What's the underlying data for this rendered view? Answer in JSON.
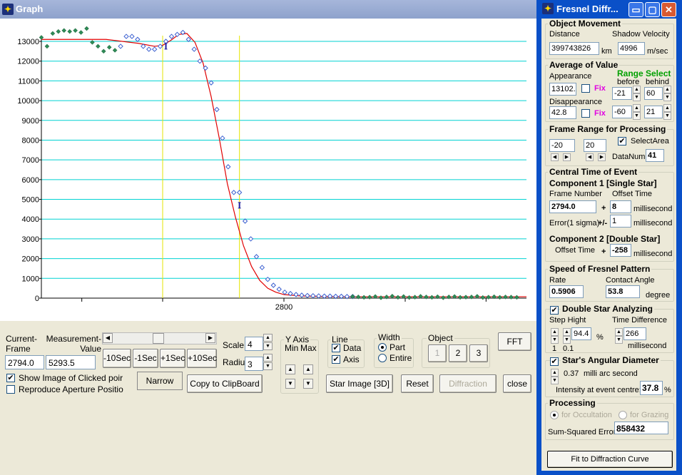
{
  "graph_window": {
    "title": "Graph"
  },
  "chart_data": {
    "type": "scatter",
    "title": "",
    "xlabel": "",
    "ylabel": "",
    "ylim": [
      0,
      14000
    ],
    "yticks": [
      0,
      1000,
      2000,
      3000,
      4000,
      5000,
      6000,
      7000,
      8000,
      9000,
      10000,
      11000,
      12000,
      13000
    ],
    "xtick_labels": [
      "2800"
    ],
    "xtick_values": [
      2800
    ],
    "xlim": [
      2770,
      2830
    ],
    "grid": "horizontal",
    "vertical_markers": [
      2785,
      2794.5
    ],
    "colors": {
      "observed": "#2e8b57",
      "used": "#3a5fd0",
      "fit": "#e00000",
      "grid": "#00d2d2",
      "marker": "#e6e600"
    },
    "series": [
      {
        "kind": "observed",
        "x": [
          2770,
          2770.7,
          2771.4,
          2772.1,
          2772.8,
          2773.5,
          2774.2,
          2774.9,
          2775.6,
          2776.3,
          2777,
          2777.7,
          2778.4,
          2779.1
        ],
        "y": [
          13200,
          12750,
          13400,
          13500,
          13550,
          13500,
          13550,
          13450,
          13650,
          12950,
          12750,
          12500,
          12700,
          12550
        ]
      },
      {
        "kind": "used",
        "x": [
          2779.8,
          2780.5,
          2781.2,
          2781.9,
          2782.6,
          2783.3,
          2784,
          2784.7,
          2785.4,
          2786.1,
          2786.8,
          2787.5,
          2788.2,
          2788.9,
          2789.6,
          2790.3,
          2791,
          2791.7,
          2792.4,
          2793.1,
          2793.8,
          2794.5,
          2795.2,
          2795.9,
          2796.6,
          2797.3,
          2798,
          2798.7,
          2799.4,
          2800.1,
          2800.8,
          2801.5,
          2802.2,
          2802.9,
          2803.6,
          2804.3,
          2805,
          2805.7,
          2806.4,
          2807.1,
          2807.8,
          2808.5
        ],
        "y": [
          12750,
          13250,
          13250,
          13100,
          12750,
          12600,
          12600,
          12750,
          13000,
          13250,
          13350,
          13450,
          13100,
          12600,
          12000,
          11650,
          10900,
          9550,
          8100,
          6650,
          5350,
          5350,
          3900,
          3000,
          2100,
          1550,
          950,
          650,
          450,
          300,
          230,
          180,
          150,
          130,
          120,
          110,
          100,
          100,
          90,
          90,
          80,
          80
        ]
      },
      {
        "kind": "observed",
        "x": [
          2808.5,
          2809.2,
          2809.9,
          2810.6,
          2811.3,
          2812,
          2812.7,
          2813.4,
          2814.1,
          2814.8,
          2815.5,
          2816.2,
          2816.9,
          2817.6,
          2818.3,
          2819,
          2819.7,
          2820.4,
          2821.1,
          2821.8,
          2822.5,
          2823.2,
          2823.9,
          2824.6,
          2825.3,
          2826,
          2826.7,
          2827.4,
          2828.1,
          2828.8
        ],
        "y": [
          80,
          60,
          40,
          50,
          80,
          20,
          60,
          100,
          40,
          80,
          30,
          50,
          90,
          60,
          40,
          70,
          20,
          60,
          80,
          40,
          50,
          60,
          90,
          30,
          50,
          70,
          40,
          60,
          50,
          40
        ]
      },
      {
        "kind": "fit",
        "x": [
          2770,
          2775,
          2778,
          2780,
          2782,
          2784,
          2785,
          2786,
          2787,
          2788,
          2789,
          2790,
          2791,
          2792,
          2793,
          2794,
          2795,
          2796,
          2797,
          2798,
          2799,
          2800,
          2802,
          2805,
          2810,
          2820,
          2830
        ],
        "y": [
          13100,
          13100,
          13100,
          13000,
          12900,
          12750,
          12800,
          13050,
          13350,
          13400,
          12950,
          11900,
          10200,
          8100,
          5800,
          4100,
          2650,
          1600,
          900,
          500,
          300,
          180,
          110,
          80,
          70,
          70,
          70
        ]
      }
    ],
    "error_bars": [
      {
        "x": 2785.4,
        "y": 12750
      },
      {
        "x": 2794.5,
        "y": 4700
      }
    ]
  },
  "controls": {
    "current_frame_label": "Current-\nFrame",
    "current_frame_value": "2794.0",
    "measurement_label": "Measurement-\nValue",
    "measurement_value": "5293.5",
    "btn_m10": "-10Sec",
    "btn_m1": "-1Sec",
    "btn_p1": "+1Sec",
    "btn_p10": "+10Sec",
    "scale_label": "Scale",
    "scale_value": "4",
    "radius_label": "Radiu",
    "radius_value": "3",
    "yaxis_label": "Y Axis",
    "min_label": "Min",
    "max_label": "Max",
    "line_label": "Line",
    "line_data": "Data",
    "line_axis": "Axis",
    "width_label": "Width",
    "width_part": "Part",
    "width_entire": "Entire",
    "object_label": "Object",
    "obj1": "1",
    "obj2": "2",
    "obj3": "3",
    "fft": "FFT",
    "show_image": "Show Image of Clicked poir",
    "reproduce": "Reproduce Aperture Positio",
    "narrow": "Narrow",
    "copy": "Copy to ClipBoard",
    "star_image": "Star Image [3D]",
    "reset": "Reset",
    "diffraction": "Diffraction",
    "close": "close"
  },
  "fresnel": {
    "title": "Fresnel Diffr...",
    "object_movement": "Object Movement",
    "distance_label": "Distance",
    "distance_value": "399743826",
    "km": "km",
    "shadow_label": "Shadow Velocity",
    "shadow_value": "4996",
    "mps": "m/sec",
    "average": "Average of Value",
    "appearance": "Appearance",
    "appearance_value": "13102.",
    "range_select": "Range Select",
    "before": "before",
    "behind": "behind",
    "fix": "Fix",
    "app_before": "-21",
    "app_behind": "60",
    "disappearance": "Disappearance",
    "disappearance_value": "42.8",
    "dis_before": "-60",
    "dis_behind": "21",
    "frame_range": "Frame Range for Processing",
    "fr_start": "-20",
    "fr_end": "20",
    "select_area": "SelectArea",
    "datanum_label": "DataNum",
    "datanum": "41",
    "central_time": "Central Time of  Event",
    "comp1": "Component 1   [Single Star]",
    "frame_number": "Frame Number",
    "offset_time": "Offset Time",
    "frame_value": "2794.0",
    "offset_value": "8",
    "millisecond": "millisecond",
    "error_label": "Error(1 sigma)",
    "pm": "+/-",
    "error_value": "1",
    "plus": "+",
    "comp2": "Component 2    [Double Star]",
    "offset_time2": "Offset Time",
    "offset2_value": "-258",
    "speed": "Speed of Fresnel Pattern",
    "rate": "Rate",
    "rate_value": "0.5906",
    "contact": "Contact Angle",
    "contact_value": "53.8",
    "degree": "degree",
    "double_star": "Double Star Analyzing",
    "step_hight": "Step Hight",
    "step_value": "94.4",
    "pct": "%",
    "time_diff": "Time Difference",
    "time_diff_value": "266",
    "step1": "1",
    "step01": "0.1",
    "angular": "Star's Angular Diameter",
    "angular_value": "0.37",
    "mas": "milli arc second",
    "intensity_label": "Intensity at event centre:",
    "intensity_value": "37.8",
    "processing": "Processing",
    "occultation": "for Occultation",
    "grazing": "for Grazing",
    "sse_label": "Sum-Squared Error",
    "sse_value": "858432",
    "fit": "Fit to Diffraction Curve"
  }
}
